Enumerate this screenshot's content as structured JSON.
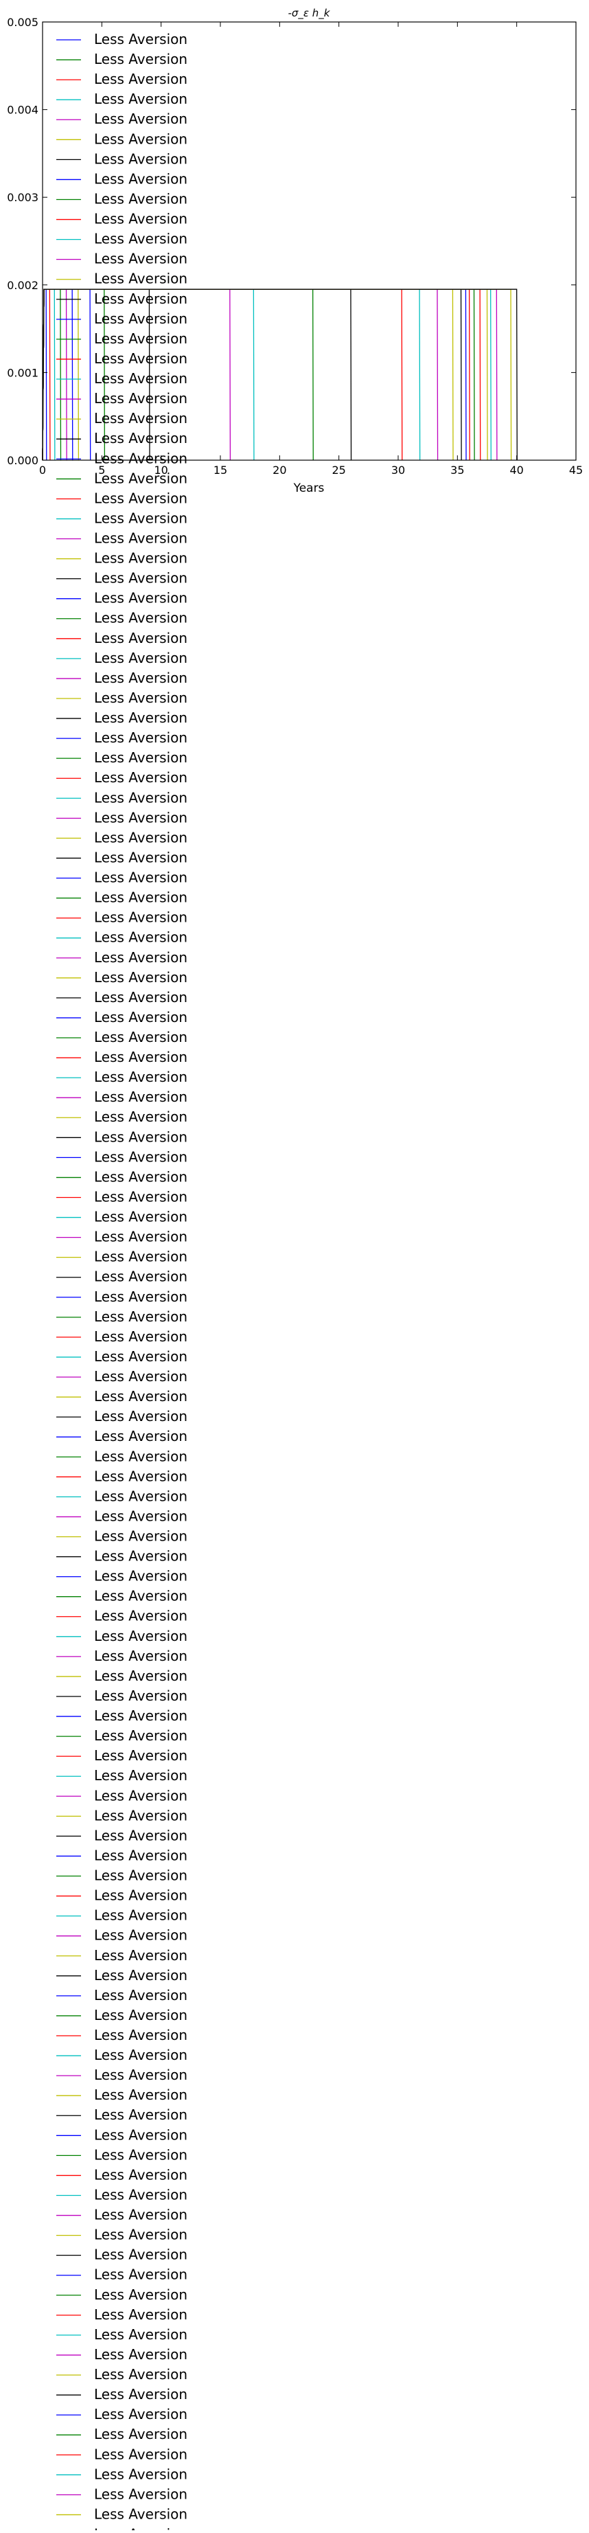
{
  "chart_data": {
    "type": "line",
    "title": "-σ_ε h_k",
    "xlabel": "Years",
    "ylabel": "",
    "xlim": [
      0,
      45
    ],
    "ylim": [
      0,
      0.005
    ],
    "xticks": [
      0,
      5,
      10,
      15,
      20,
      25,
      30,
      35,
      40,
      45
    ],
    "yticks": [
      0.0,
      0.001,
      0.002,
      0.003,
      0.004,
      0.005
    ],
    "xtick_labels": [
      "0",
      "5",
      "10",
      "15",
      "20",
      "25",
      "30",
      "35",
      "40",
      "45"
    ],
    "ytick_labels": [
      "0.000",
      "0.001",
      "0.002",
      "0.003",
      "0.004",
      "0.005"
    ],
    "grid": false,
    "legend_placement": "top-left",
    "series_color_cycle": [
      "#0000ff",
      "#008000",
      "#ff0000",
      "#00bfbf",
      "#bf00bf",
      "#bfbf00",
      "#000000"
    ],
    "series_label": "Less Aversion",
    "series_count": 126,
    "plateau_value": 0.00195,
    "drop_years": [
      0.3,
      5.2,
      0.6,
      1.0,
      2.0,
      3.0,
      9.0,
      4.0,
      1.5,
      36.0,
      17.8,
      15.8,
      37.5,
      26.0,
      2.5,
      22.8,
      30.3,
      31.8,
      33.3,
      34.6,
      35.3,
      35.7,
      36.4,
      36.9,
      37.8,
      38.3,
      39.5,
      40.0
    ]
  }
}
